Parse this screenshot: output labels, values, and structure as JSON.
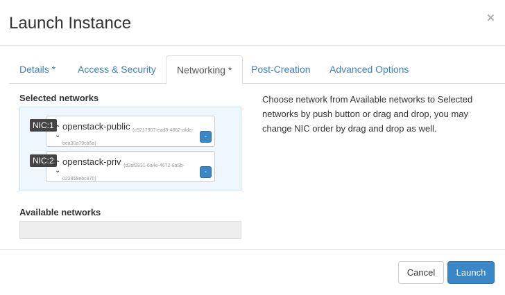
{
  "dialog": {
    "title": "Launch Instance",
    "close_symbol": "×"
  },
  "tabs": [
    {
      "label": "Details *",
      "active": false
    },
    {
      "label": "Access & Security",
      "active": false
    },
    {
      "label": "Networking *",
      "active": true
    },
    {
      "label": "Post-Creation",
      "active": false
    },
    {
      "label": "Advanced Options",
      "active": false
    }
  ],
  "networking": {
    "selected_label": "Selected networks",
    "selected": [
      {
        "nic": "NIC:1",
        "name": "openstack-public",
        "id": "(c5217907-ead8-4862-afda-bea30a79cb5a)",
        "remove": "-"
      },
      {
        "nic": "NIC:2",
        "name": "openstack-priv",
        "id": "(d2af2831-6a4e-4672-8a9b-022958ebc870)",
        "remove": "-"
      }
    ],
    "available_label": "Available networks",
    "help_text": "Choose network from Available networks to Selected networks by push button or drag and drop, you may change NIC order by drag and drop as well."
  },
  "footer": {
    "cancel_label": "Cancel",
    "launch_label": "Launch"
  },
  "colors": {
    "accent": "#3a87c8",
    "link": "#3b7fc4",
    "selected_bg": "#eef7fd"
  },
  "icons": {
    "sort": "sort-arrows-icon",
    "close": "close-icon"
  }
}
